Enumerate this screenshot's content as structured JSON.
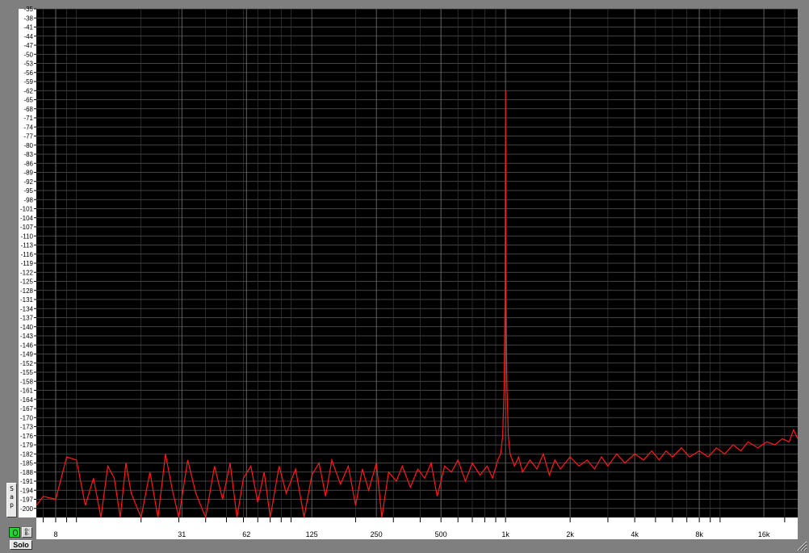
{
  "controls": {
    "snap_label": "S\na\np",
    "solo_label": "Solo",
    "small_button_label": "o-\n8-"
  },
  "colors": {
    "background": "#000000",
    "grid": "#5a5a5a",
    "trace": "#ff1a1a",
    "panel": "#7f7f7f"
  },
  "chart_data": {
    "type": "line",
    "title": "",
    "xlabel": "",
    "ylabel": "",
    "x_scale": "log",
    "xlim": [
      6.5,
      23000
    ],
    "ylim": [
      -203,
      -35
    ],
    "grid": true,
    "y_ticks": [
      -35,
      -38,
      -41,
      -44,
      -47,
      -50,
      -53,
      -56,
      -59,
      -62,
      -65,
      -68,
      -71,
      -74,
      -77,
      -80,
      -83,
      -86,
      -89,
      -92,
      -95,
      -98,
      -101,
      -104,
      -107,
      -110,
      -113,
      -116,
      -119,
      -122,
      -125,
      -128,
      -131,
      -134,
      -137,
      -140,
      -143,
      -146,
      -149,
      -152,
      -155,
      -158,
      -161,
      -164,
      -167,
      -170,
      -173,
      -176,
      -179,
      -182,
      -185,
      -188,
      -191,
      -194,
      -197,
      -200
    ],
    "x_ticks": [
      {
        "v": 8,
        "label": "8"
      },
      {
        "v": 31,
        "label": "31"
      },
      {
        "v": 62,
        "label": "62"
      },
      {
        "v": 125,
        "label": "125"
      },
      {
        "v": 250,
        "label": "250"
      },
      {
        "v": 500,
        "label": "500"
      },
      {
        "v": 1000,
        "label": "1k"
      },
      {
        "v": 2000,
        "label": "2k"
      },
      {
        "v": 4000,
        "label": "4k"
      },
      {
        "v": 8000,
        "label": "8k"
      },
      {
        "v": 16000,
        "label": "16k"
      }
    ],
    "series": [
      {
        "points": [
          [
            6.5,
            -199
          ],
          [
            7,
            -196
          ],
          [
            8,
            -197
          ],
          [
            9,
            -183
          ],
          [
            10,
            -184
          ],
          [
            11,
            -199
          ],
          [
            12,
            -190
          ],
          [
            13,
            -203
          ],
          [
            14,
            -186
          ],
          [
            15,
            -190
          ],
          [
            16,
            -203
          ],
          [
            17,
            -185
          ],
          [
            18,
            -195
          ],
          [
            20,
            -203
          ],
          [
            22,
            -188
          ],
          [
            24,
            -203
          ],
          [
            26,
            -182
          ],
          [
            28,
            -194
          ],
          [
            30,
            -203
          ],
          [
            33,
            -184
          ],
          [
            36,
            -195
          ],
          [
            40,
            -203
          ],
          [
            44,
            -186
          ],
          [
            48,
            -197
          ],
          [
            52,
            -185
          ],
          [
            56,
            -203
          ],
          [
            60,
            -190
          ],
          [
            65,
            -186
          ],
          [
            70,
            -198
          ],
          [
            75,
            -188
          ],
          [
            80,
            -203
          ],
          [
            88,
            -186
          ],
          [
            95,
            -195
          ],
          [
            105,
            -187
          ],
          [
            115,
            -203
          ],
          [
            125,
            -189
          ],
          [
            135,
            -185
          ],
          [
            145,
            -196
          ],
          [
            155,
            -184
          ],
          [
            170,
            -192
          ],
          [
            185,
            -186
          ],
          [
            200,
            -199
          ],
          [
            215,
            -187
          ],
          [
            230,
            -194
          ],
          [
            250,
            -185
          ],
          [
            265,
            -203
          ],
          [
            285,
            -188
          ],
          [
            310,
            -191
          ],
          [
            330,
            -186
          ],
          [
            360,
            -193
          ],
          [
            390,
            -187
          ],
          [
            420,
            -190
          ],
          [
            450,
            -185
          ],
          [
            480,
            -196
          ],
          [
            520,
            -186
          ],
          [
            560,
            -188
          ],
          [
            600,
            -184
          ],
          [
            650,
            -191
          ],
          [
            700,
            -185
          ],
          [
            760,
            -189
          ],
          [
            820,
            -186
          ],
          [
            870,
            -190
          ],
          [
            920,
            -184
          ],
          [
            950,
            -182
          ],
          [
            970,
            -176
          ],
          [
            985,
            -160
          ],
          [
            995,
            -130
          ],
          [
            1000,
            -62
          ],
          [
            1005,
            -130
          ],
          [
            1015,
            -160
          ],
          [
            1030,
            -176
          ],
          [
            1050,
            -182
          ],
          [
            1100,
            -186
          ],
          [
            1150,
            -183
          ],
          [
            1200,
            -188
          ],
          [
            1300,
            -184
          ],
          [
            1400,
            -187
          ],
          [
            1500,
            -182
          ],
          [
            1600,
            -189
          ],
          [
            1700,
            -184
          ],
          [
            1800,
            -187
          ],
          [
            2000,
            -183
          ],
          [
            2200,
            -186
          ],
          [
            2400,
            -184
          ],
          [
            2600,
            -187
          ],
          [
            2800,
            -183
          ],
          [
            3000,
            -186
          ],
          [
            3300,
            -182
          ],
          [
            3600,
            -185
          ],
          [
            4000,
            -182
          ],
          [
            4400,
            -184
          ],
          [
            4800,
            -181
          ],
          [
            5200,
            -184
          ],
          [
            5600,
            -181
          ],
          [
            6000,
            -183
          ],
          [
            6600,
            -180
          ],
          [
            7200,
            -183
          ],
          [
            8000,
            -181
          ],
          [
            8800,
            -183
          ],
          [
            9600,
            -180
          ],
          [
            10500,
            -182
          ],
          [
            11500,
            -179
          ],
          [
            12500,
            -181
          ],
          [
            13500,
            -178
          ],
          [
            15000,
            -180
          ],
          [
            16500,
            -178
          ],
          [
            18000,
            -179
          ],
          [
            19500,
            -177
          ],
          [
            21000,
            -178
          ],
          [
            22000,
            -174
          ],
          [
            23000,
            -177
          ]
        ]
      }
    ]
  }
}
